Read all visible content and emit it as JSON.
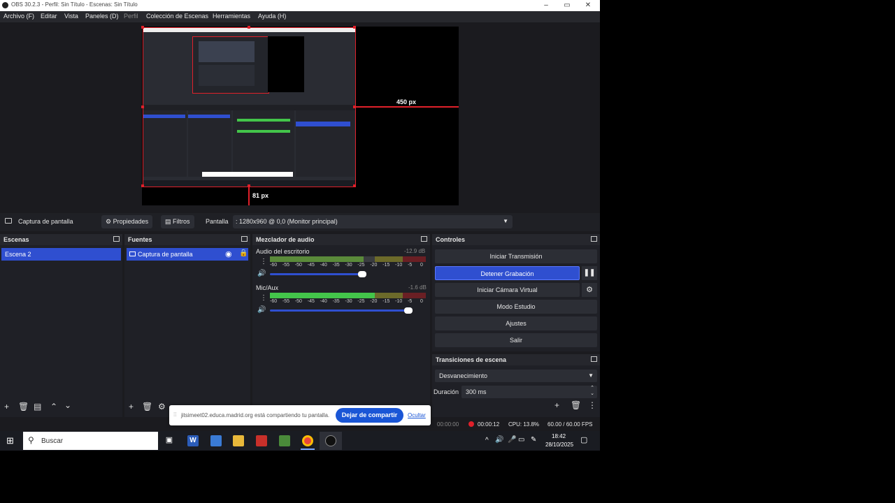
{
  "titlebar": {
    "title": "OBS 30.2.3 - Perfil: Sin Título - Escenas: Sin Título"
  },
  "menu": [
    "Archivo (F)",
    "Editar",
    "Vista",
    "Paneles (D)",
    "Perfil",
    "Colección de Escenas",
    "Herramientas",
    "Ayuda (H)"
  ],
  "preview": {
    "right_label": "450 px",
    "bottom_label": "81 px"
  },
  "source_toolbar": {
    "source_name": "Captura de pantalla",
    "properties": "Propiedades",
    "filters": "Filtros",
    "screen_label": "Pantalla",
    "screen_value": ": 1280x960 @ 0,0 (Monitor principal)"
  },
  "scenes": {
    "title": "Escenas",
    "items": [
      "Escena 2"
    ]
  },
  "sources": {
    "title": "Fuentes",
    "items": [
      "Captura de pantalla"
    ]
  },
  "mixer": {
    "title": "Mezclador de audio",
    "channels": [
      {
        "name": "Audio del escritorio",
        "db": "-12.9 dB",
        "level": 0.6,
        "volume": 0.98
      },
      {
        "name": "Mic/Aux",
        "db": "-1.6 dB",
        "level": 0.68,
        "volume": 0.96
      }
    ],
    "scale": [
      "-60",
      "-55",
      "-50",
      "-45",
      "-40",
      "-35",
      "-30",
      "-25",
      "-20",
      "-15",
      "-10",
      "-5",
      "0"
    ]
  },
  "controls": {
    "title": "Controles",
    "start_stream": "Iniciar Transmisión",
    "stop_record": "Detener Grabación",
    "virtual_cam": "Iniciar Cámara Virtual",
    "studio_mode": "Modo Estudio",
    "settings": "Ajustes",
    "exit": "Salir"
  },
  "transitions": {
    "title": "Transiciones de escena",
    "selected": "Desvanecimiento",
    "duration_label": "Duración",
    "duration_value": "300 ms"
  },
  "status": {
    "stream_time": "00:00:00",
    "rec_time": "00:00:12",
    "cpu": "CPU: 13.8%",
    "fps": "60.00 / 60.00 FPS"
  },
  "share_notice": {
    "text": "jitsimeet02.educa.madrid.org está compartiendo tu pantalla.",
    "stop": "Dejar de compartir",
    "hide": "Ocultar"
  },
  "taskbar": {
    "search": "Buscar",
    "time": "18:42",
    "date": "28/10/2025"
  },
  "colors": {
    "accent": "#2f4fd0",
    "record": "#e0202a"
  }
}
